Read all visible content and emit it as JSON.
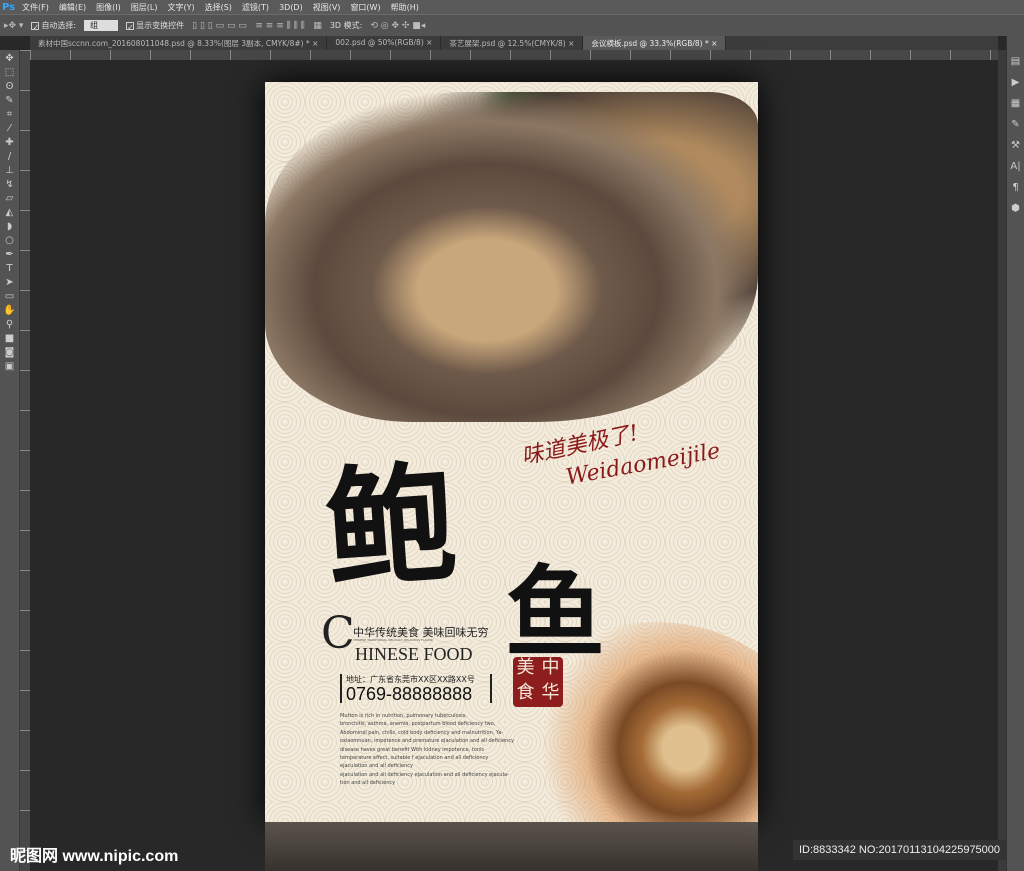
{
  "app": {
    "logo": "Ps"
  },
  "menu": [
    "文件(F)",
    "编辑(E)",
    "图像(I)",
    "图层(L)",
    "文字(Y)",
    "选择(S)",
    "滤镜(T)",
    "3D(D)",
    "视图(V)",
    "窗口(W)",
    "帮助(H)"
  ],
  "options": {
    "auto_select_label": "自动选择:",
    "auto_select_value": "组",
    "show_transform_label": "显示变换控件",
    "mode_3d_label": "3D 模式:"
  },
  "tabs": [
    {
      "label": "素材中国sccnn.com_201608011048.psd @ 8.33%(图层 3副本, CMYK/8#) *"
    },
    {
      "label": "002.psd @ 50%(RGB/8)"
    },
    {
      "label": "茶艺展架.psd @ 12.5%(CMYK/8)"
    },
    {
      "label": "会议横板.psd @ 33.3%(RGB/8) *",
      "active": true
    }
  ],
  "poster": {
    "title_char1": "鲍",
    "title_char2": "鱼",
    "slogan_cn": "味道美极了!",
    "slogan_pinyin": "Weidaomeijile",
    "tagline": "中华传统美食  美味回味无穷",
    "tagline_small": "CHINESE TRADITIONAL DELICACY DELICIOUS FLAVOR",
    "english_big_letter": "C",
    "english_rest": "HINESE FOOD",
    "address": "地址：广东省东莞市XX区XX路XX号",
    "phone": "0769-88888888",
    "seal_chars": [
      "中",
      "美",
      "华",
      "食"
    ],
    "body_lines": [
      "Mutton is rich in nutrition, pulmonary tuberculosis,",
      "bronchitis, asthma, anemia, postpartum blood deficiency two,",
      "Abdominal pain, chills, cold body deficiency and malnutrition, Ya-",
      "oxiaomnuan, impotence and premature ejaculation and all deficiency",
      "disease haves great benefit With kidney impotence, tonic",
      "temperature effect, suitable f ejaculation and all deficiency",
      " ejaculation and all deficiency",
      " ejaculation and all deficiency  ejaculation and all deficiency  ejacula-",
      "tion and all deficiency"
    ]
  },
  "watermark": "昵图网 www.nipic.com",
  "image_id": "ID:8833342 NO:20170113104225975000"
}
